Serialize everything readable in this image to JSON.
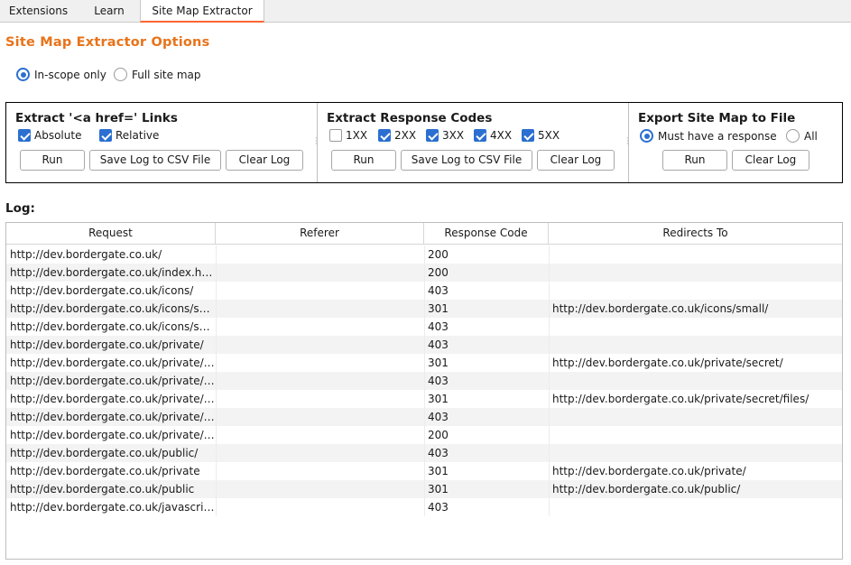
{
  "tabs": [
    {
      "label": "Extensions",
      "active": false
    },
    {
      "label": "Learn",
      "active": false
    },
    {
      "label": "Site Map Extractor",
      "active": true
    }
  ],
  "title": "Site Map Extractor Options",
  "scope": {
    "options": [
      {
        "label": "In-scope only",
        "selected": true
      },
      {
        "label": "Full site map",
        "selected": false
      }
    ]
  },
  "panels": {
    "links": {
      "title": "Extract '<a href=' Links",
      "checkboxes": [
        {
          "label": "Absolute",
          "checked": true
        },
        {
          "label": "Relative",
          "checked": true
        }
      ],
      "buttons": [
        "Run",
        "Save Log to CSV File",
        "Clear Log"
      ]
    },
    "codes": {
      "title": "Extract Response Codes",
      "checkboxes": [
        {
          "label": "1XX",
          "checked": false
        },
        {
          "label": "2XX",
          "checked": true
        },
        {
          "label": "3XX",
          "checked": true
        },
        {
          "label": "4XX",
          "checked": true
        },
        {
          "label": "5XX",
          "checked": true
        }
      ],
      "buttons": [
        "Run",
        "Save Log to CSV File",
        "Clear Log"
      ]
    },
    "export": {
      "title": "Export Site Map to File",
      "radios": [
        {
          "label": "Must have a response",
          "selected": true
        },
        {
          "label": "All",
          "selected": false
        }
      ],
      "buttons": [
        "Run",
        "Clear Log"
      ]
    }
  },
  "log": {
    "label": "Log:",
    "columns": [
      "Request",
      "Referer",
      "Response Code",
      "Redirects To"
    ],
    "rows": [
      [
        "http://dev.bordergate.co.uk/",
        "",
        "200",
        ""
      ],
      [
        "http://dev.bordergate.co.uk/index.html",
        "",
        "200",
        ""
      ],
      [
        "http://dev.bordergate.co.uk/icons/",
        "",
        "403",
        ""
      ],
      [
        "http://dev.bordergate.co.uk/icons/small",
        "",
        "301",
        "http://dev.bordergate.co.uk/icons/small/"
      ],
      [
        "http://dev.bordergate.co.uk/icons/sma...",
        "",
        "403",
        ""
      ],
      [
        "http://dev.bordergate.co.uk/private/",
        "",
        "403",
        ""
      ],
      [
        "http://dev.bordergate.co.uk/private/se...",
        "",
        "301",
        "http://dev.bordergate.co.uk/private/secret/"
      ],
      [
        "http://dev.bordergate.co.uk/private/se...",
        "",
        "403",
        ""
      ],
      [
        "http://dev.bordergate.co.uk/private/se...",
        "",
        "301",
        "http://dev.bordergate.co.uk/private/secret/files/"
      ],
      [
        "http://dev.bordergate.co.uk/private/se...",
        "",
        "403",
        ""
      ],
      [
        "http://dev.bordergate.co.uk/private/se...",
        "",
        "200",
        ""
      ],
      [
        "http://dev.bordergate.co.uk/public/",
        "",
        "403",
        ""
      ],
      [
        "http://dev.bordergate.co.uk/private",
        "",
        "301",
        "http://dev.bordergate.co.uk/private/"
      ],
      [
        "http://dev.bordergate.co.uk/public",
        "",
        "301",
        "http://dev.bordergate.co.uk/public/"
      ],
      [
        "http://dev.bordergate.co.uk/javascript/",
        "",
        "403",
        ""
      ]
    ]
  }
}
